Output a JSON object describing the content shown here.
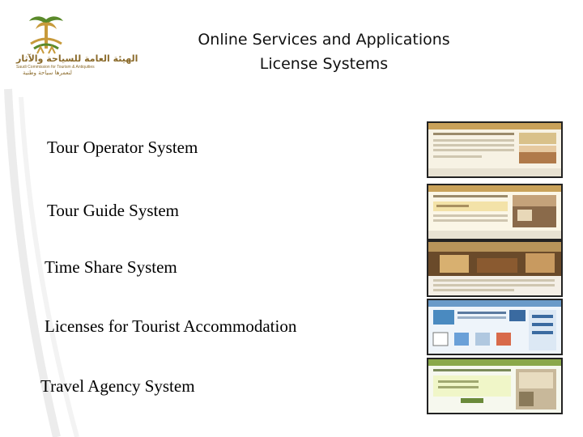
{
  "logo": {
    "arabic_name": "الهيئة العامة للسياحة والآثار",
    "english_name": "Saudi Commission for Tourism & Antiquities",
    "arabic_slogan": "لنعمرها سياحة وطنية",
    "colors": {
      "gold": "#c79a3b",
      "green": "#5a8a2a"
    }
  },
  "header": {
    "title_line1": "Online Services and Applications",
    "title_line2": "License Systems"
  },
  "systems": [
    {
      "label": "Tour Operator System",
      "thumb_icon": "tour-operator-screenshot"
    },
    {
      "label": "Tour Guide System",
      "thumb_icon": "tour-guide-screenshot"
    },
    {
      "label": "Time Share System",
      "thumb_icon": "time-share-screenshot"
    },
    {
      "label": "Licenses for Tourist Accommodation",
      "thumb_icon": "tourist-accommodation-screenshot"
    },
    {
      "label": "Travel Agency System",
      "thumb_icon": "travel-agency-screenshot"
    }
  ]
}
